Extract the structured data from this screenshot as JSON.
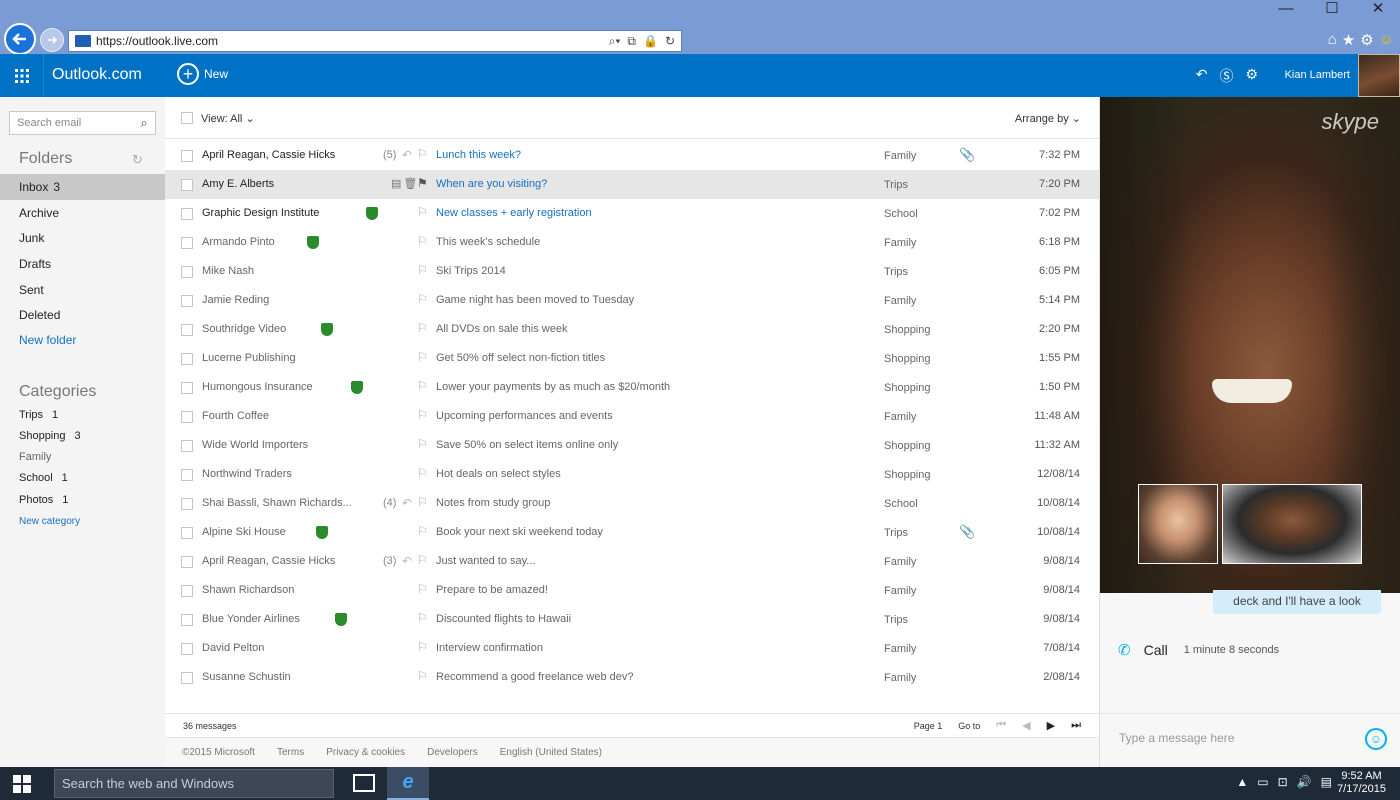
{
  "browser": {
    "url": "https://outlook.live.com",
    "window_controls": [
      "—",
      "☐",
      "✕"
    ],
    "tools": [
      "⌂",
      "★",
      "⚙",
      "☺"
    ],
    "addr_icons": [
      "⌕▾",
      "⧉",
      "🔒",
      "↻"
    ]
  },
  "header": {
    "brand": "Outlook.com",
    "new_label": "New",
    "user_name": "Kian Lambert"
  },
  "sidebar": {
    "search_placeholder": "Search email",
    "folders_title": "Folders",
    "folders": [
      {
        "label": "Inbox",
        "count": "3"
      },
      {
        "label": "Archive",
        "count": ""
      },
      {
        "label": "Junk",
        "count": ""
      },
      {
        "label": "Drafts",
        "count": ""
      },
      {
        "label": "Sent",
        "count": ""
      },
      {
        "label": "Deleted",
        "count": ""
      }
    ],
    "new_folder": "New folder",
    "categories_title": "Categories",
    "categories": [
      {
        "label": "Trips",
        "count": "1"
      },
      {
        "label": "Shopping",
        "count": "3"
      },
      {
        "label": "Family",
        "count": ""
      },
      {
        "label": "School",
        "count": "1"
      },
      {
        "label": "Photos",
        "count": "1"
      }
    ],
    "new_category": "New category"
  },
  "list": {
    "view_label": "View: All",
    "arrange_label": "Arrange by",
    "messages": [
      {
        "from": "April Reagan, Cassie Hicks",
        "count": "(5)",
        "subject": "Lunch this week?",
        "category": "Family",
        "time": "7:32 PM"
      },
      {
        "from": "Amy E. Alberts",
        "count": "",
        "subject": "When are you visiting?",
        "category": "Trips",
        "time": "7:20 PM"
      },
      {
        "from": "Graphic Design Institute",
        "count": "",
        "subject": "New classes + early registration",
        "category": "School",
        "time": "7:02 PM"
      },
      {
        "from": "Armando Pinto",
        "count": "",
        "subject": "This week's schedule",
        "category": "Family",
        "time": "6:18 PM"
      },
      {
        "from": "Mike Nash",
        "count": "",
        "subject": "Ski Trips 2014",
        "category": "Trips",
        "time": "6:05 PM"
      },
      {
        "from": "Jamie Reding",
        "count": "",
        "subject": "Game night has been moved to Tuesday",
        "category": "Family",
        "time": "5:14 PM"
      },
      {
        "from": "Southridge Video",
        "count": "",
        "subject": "All DVDs on sale this week",
        "category": "Shopping",
        "time": "2:20 PM"
      },
      {
        "from": "Lucerne Publishing",
        "count": "",
        "subject": "Get 50% off select non-fiction titles",
        "category": "Shopping",
        "time": "1:55 PM"
      },
      {
        "from": "Humongous Insurance",
        "count": "",
        "subject": "Lower your payments by as much as $20/month",
        "category": "Shopping",
        "time": "1:50 PM"
      },
      {
        "from": "Fourth Coffee",
        "count": "",
        "subject": "Upcoming performances and events",
        "category": "Family",
        "time": "11:48 AM"
      },
      {
        "from": "Wide World Importers",
        "count": "",
        "subject": "Save 50% on select items online only",
        "category": "Shopping",
        "time": "11:32 AM"
      },
      {
        "from": "Northwind Traders",
        "count": "",
        "subject": "Hot deals on select styles",
        "category": "Shopping",
        "time": "12/08/14"
      },
      {
        "from": "Shai Bassli, Shawn Richards...",
        "count": "(4)",
        "subject": "Notes from study group",
        "category": "School",
        "time": "10/08/14"
      },
      {
        "from": "Alpine Ski House",
        "count": "",
        "subject": "Book your next ski weekend today",
        "category": "Trips",
        "time": "10/08/14"
      },
      {
        "from": "April Reagan, Cassie Hicks",
        "count": "(3)",
        "subject": "Just wanted to say...",
        "category": "Family",
        "time": "9/08/14"
      },
      {
        "from": "Shawn Richardson",
        "count": "",
        "subject": "Prepare to be amazed!",
        "category": "Family",
        "time": "9/08/14"
      },
      {
        "from": "Blue Yonder Airlines",
        "count": "",
        "subject": "Discounted flights to Hawaii",
        "category": "Trips",
        "time": "9/08/14"
      },
      {
        "from": "David Pelton",
        "count": "",
        "subject": "Interview confirmation",
        "category": "Family",
        "time": "7/08/14"
      },
      {
        "from": "Susanne Schustin",
        "count": "",
        "subject": "Recommend a good freelance web dev?",
        "category": "Family",
        "time": "2/08/14"
      }
    ],
    "message_count": "36 messages",
    "page_label": "Page 1",
    "goto_label": "Go to"
  },
  "footer_links": [
    "©2015 Microsoft",
    "Terms",
    "Privacy & cookies",
    "Developers",
    "English (United States)"
  ],
  "skype": {
    "logo": "skype",
    "chat_bubble": "deck and I'll have a look",
    "call_label": "Call",
    "call_duration": "1 minute 8 seconds",
    "message_placeholder": "Type a message here"
  },
  "taskbar": {
    "search_placeholder": "Search the web and Windows",
    "time": "9:52 AM",
    "date": "7/17/2015"
  }
}
